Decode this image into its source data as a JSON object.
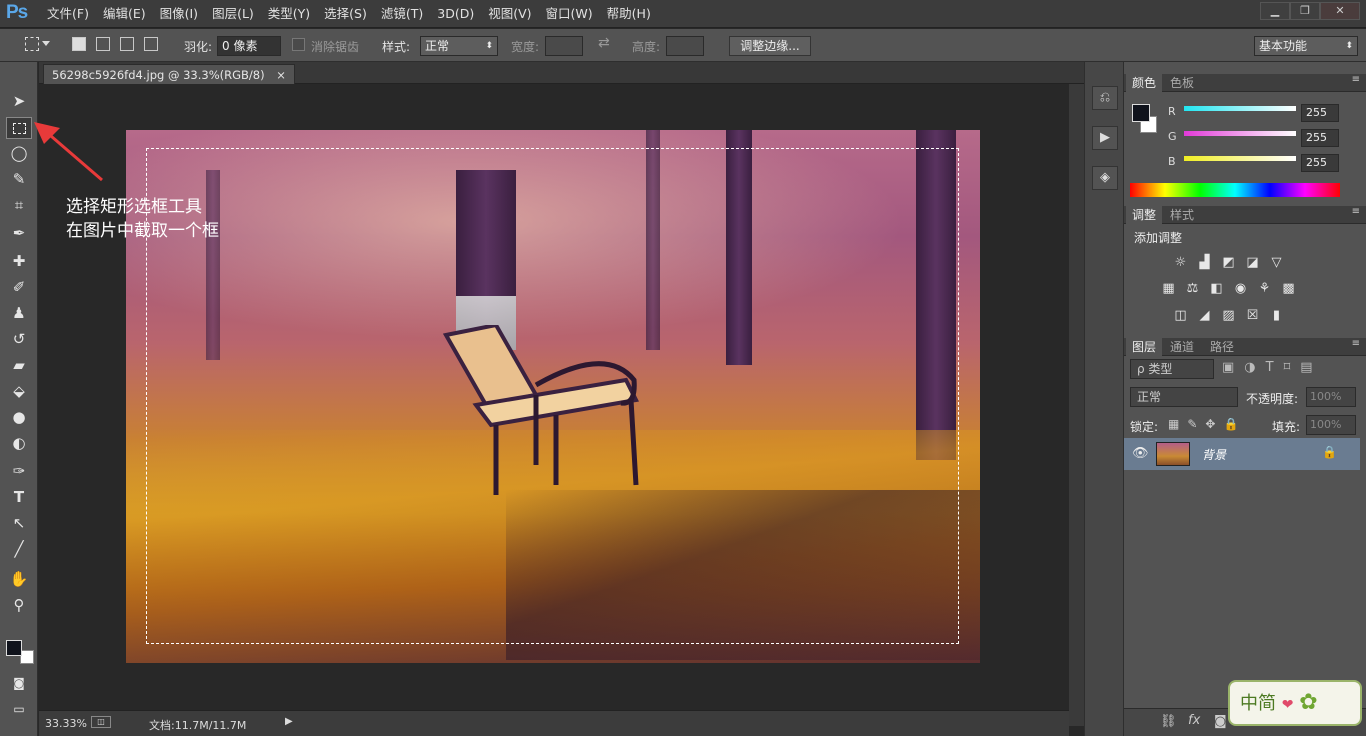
{
  "app": {
    "logo": "Ps"
  },
  "menu": [
    "文件(F)",
    "编辑(E)",
    "图像(I)",
    "图层(L)",
    "类型(Y)",
    "选择(S)",
    "滤镜(T)",
    "3D(D)",
    "视图(V)",
    "窗口(W)",
    "帮助(H)"
  ],
  "window_controls": {
    "minimize": "▁",
    "restore": "❐",
    "close": "✕"
  },
  "options": {
    "feather_label": "羽化:",
    "feather_value": "0 像素",
    "antialias_label": "消除锯齿",
    "style_label": "样式:",
    "style_value": "正常",
    "width_label": "宽度:",
    "height_label": "高度:",
    "refine_edge": "调整边缘...",
    "workspace": "基本功能"
  },
  "document": {
    "tab_title": "56298c5926fd4.jpg @ 33.3%(RGB/8)",
    "close": "×"
  },
  "annotation": {
    "line1": "选择矩形选框工具",
    "line2": "在图片中截取一个框",
    "arrow_color": "#e83a3a"
  },
  "status": {
    "zoom": "33.33%",
    "doc_info": "文档:11.7M/11.7M"
  },
  "color_panel": {
    "tabs": [
      "颜色",
      "色板"
    ],
    "channels": [
      {
        "label": "R",
        "value": "255",
        "color": "#22e5f0"
      },
      {
        "label": "G",
        "value": "255",
        "color": "#e23ad8"
      },
      {
        "label": "B",
        "value": "255",
        "color": "#f0ee22"
      }
    ]
  },
  "adjust_panel": {
    "tabs": [
      "调整",
      "样式"
    ],
    "title": "添加调整"
  },
  "layers_panel": {
    "tabs": [
      "图层",
      "通道",
      "路径"
    ],
    "filter_kind": "ρ 类型",
    "blend_mode": "正常",
    "opacity_label": "不透明度:",
    "opacity_value": "100%",
    "lock_label": "锁定:",
    "fill_label": "填充:",
    "fill_value": "100%",
    "layer_name": "背景"
  },
  "watermark": {
    "text": "中简",
    "flower": "✿"
  },
  "colors": {
    "accent_blue": "#5aa7e8",
    "layer_selected": "#6a7c91",
    "panel_bg": "#535353"
  }
}
